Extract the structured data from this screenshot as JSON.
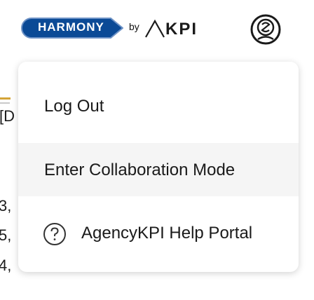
{
  "header": {
    "logo_text": "HARMONY",
    "by_text": "by",
    "akpi_text": "KPI",
    "profile_icon": "user-circle-icon"
  },
  "background": {
    "fragments": [
      "[D",
      "3,",
      "5,",
      "4,"
    ]
  },
  "menu": {
    "items": [
      {
        "label": "Log Out"
      },
      {
        "label": "Enter Collaboration Mode"
      },
      {
        "label": "AgencyKPI Help Portal",
        "icon": "question-circle-icon"
      }
    ]
  },
  "colors": {
    "logo_badge": "#0b4a96",
    "logo_badge_border": "#6f93c6",
    "menu_hover": "#f5f5f5",
    "accent_bar": "#d4a437"
  }
}
